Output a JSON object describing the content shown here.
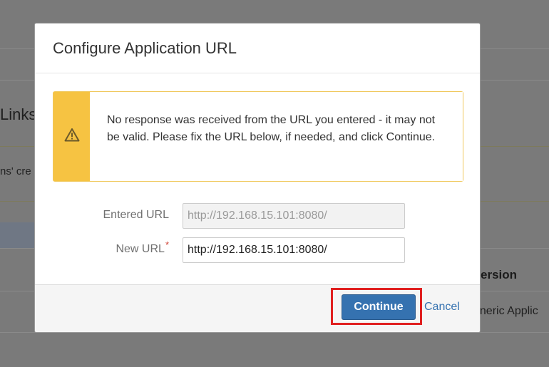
{
  "background": {
    "links_heading": "Links",
    "created_text": "ns' cre",
    "version_header": "ersion",
    "generic_cell": "eneric Applic"
  },
  "dialog": {
    "title": "Configure Application URL",
    "warning": {
      "icon": "warning-triangle-icon",
      "message": "No response was received from the URL you entered - it may not be valid. Please fix the URL below, if needed, and click Continue."
    },
    "entered_url": {
      "label": "Entered URL",
      "value": "http://192.168.15.101:8080/"
    },
    "new_url": {
      "label": "New URL",
      "required_mark": "*",
      "value": "http://192.168.15.101:8080/"
    },
    "continue_label": "Continue",
    "cancel_label": "Cancel"
  },
  "colors": {
    "primary": "#3572b0",
    "warning": "#f6c342",
    "required": "#d04437",
    "highlight": "#e02020"
  }
}
